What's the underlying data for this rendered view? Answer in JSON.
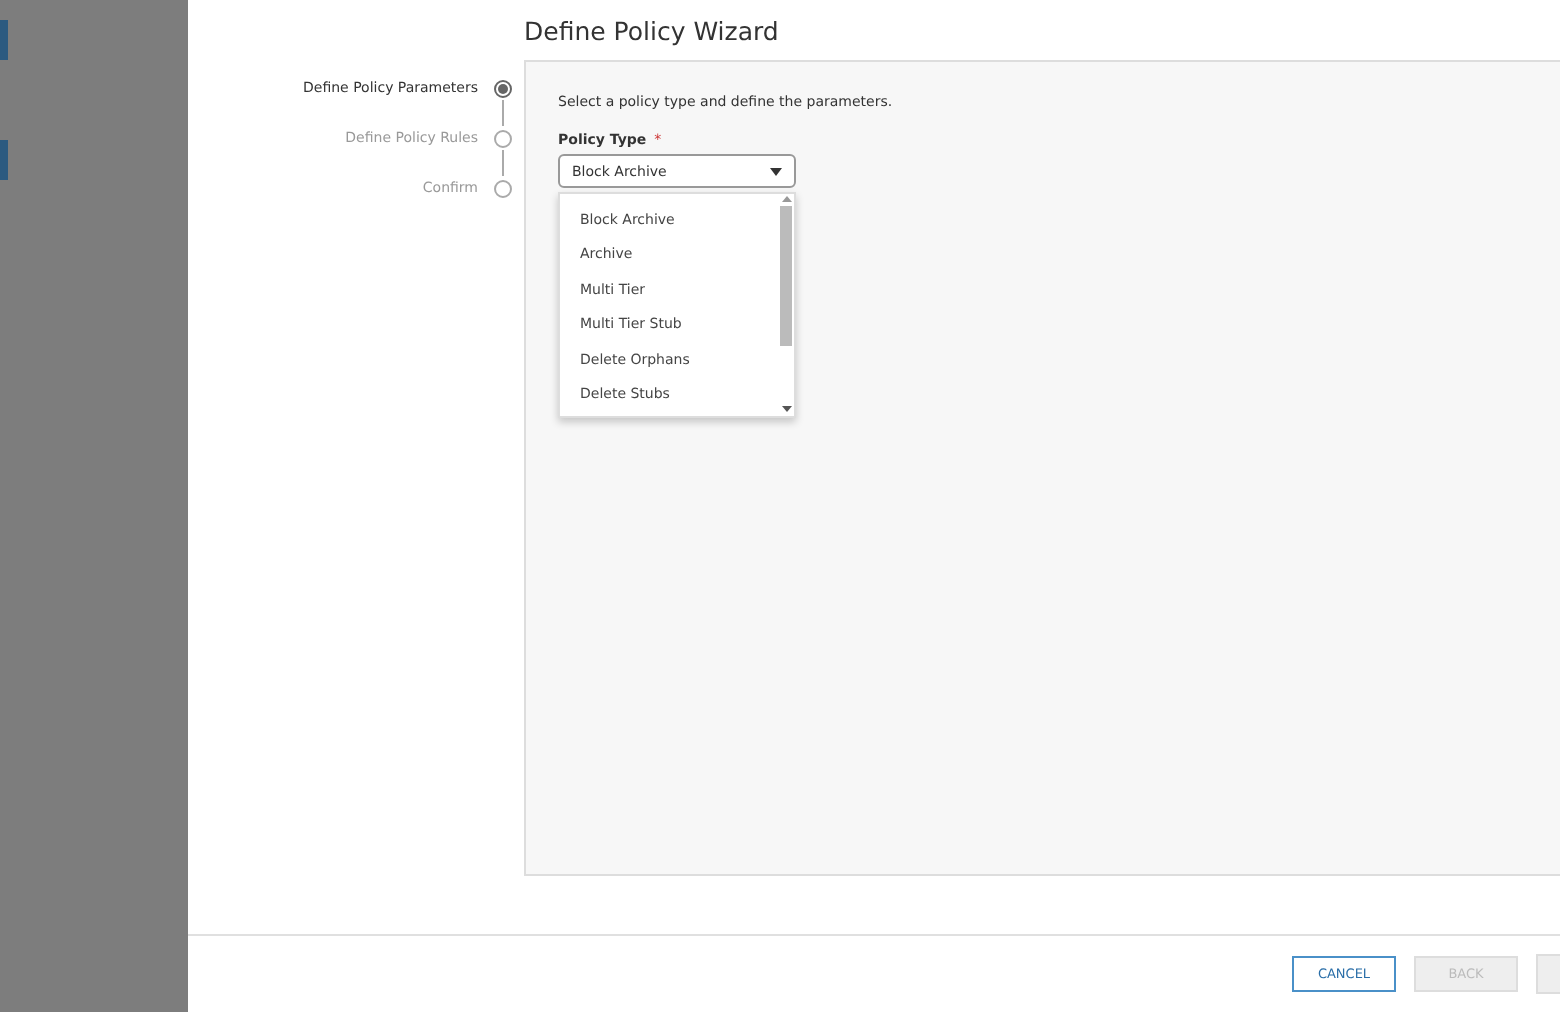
{
  "wizard": {
    "title": "Define Policy Wizard"
  },
  "steps": [
    {
      "label": "Define Policy Parameters",
      "selected": true
    },
    {
      "label": "Define Policy Rules",
      "selected": false
    },
    {
      "label": "Confirm",
      "selected": false
    }
  ],
  "content": {
    "intro": "Select a policy type and define the parameters.",
    "policy_type": {
      "label": "Policy Type",
      "required_mark": "*",
      "value": "Block Archive",
      "expanded": true,
      "options": [
        {
          "label": "Block Archive"
        },
        {
          "label": "Archive"
        },
        {
          "label": "Multi Tier"
        },
        {
          "label": "Multi Tier Stub"
        },
        {
          "label": "Delete Orphans"
        },
        {
          "label": "Delete Stubs"
        }
      ]
    }
  },
  "buttons": [
    {
      "label": "CANCEL",
      "disabled": false
    },
    {
      "label": "BACK",
      "disabled": true
    }
  ]
}
